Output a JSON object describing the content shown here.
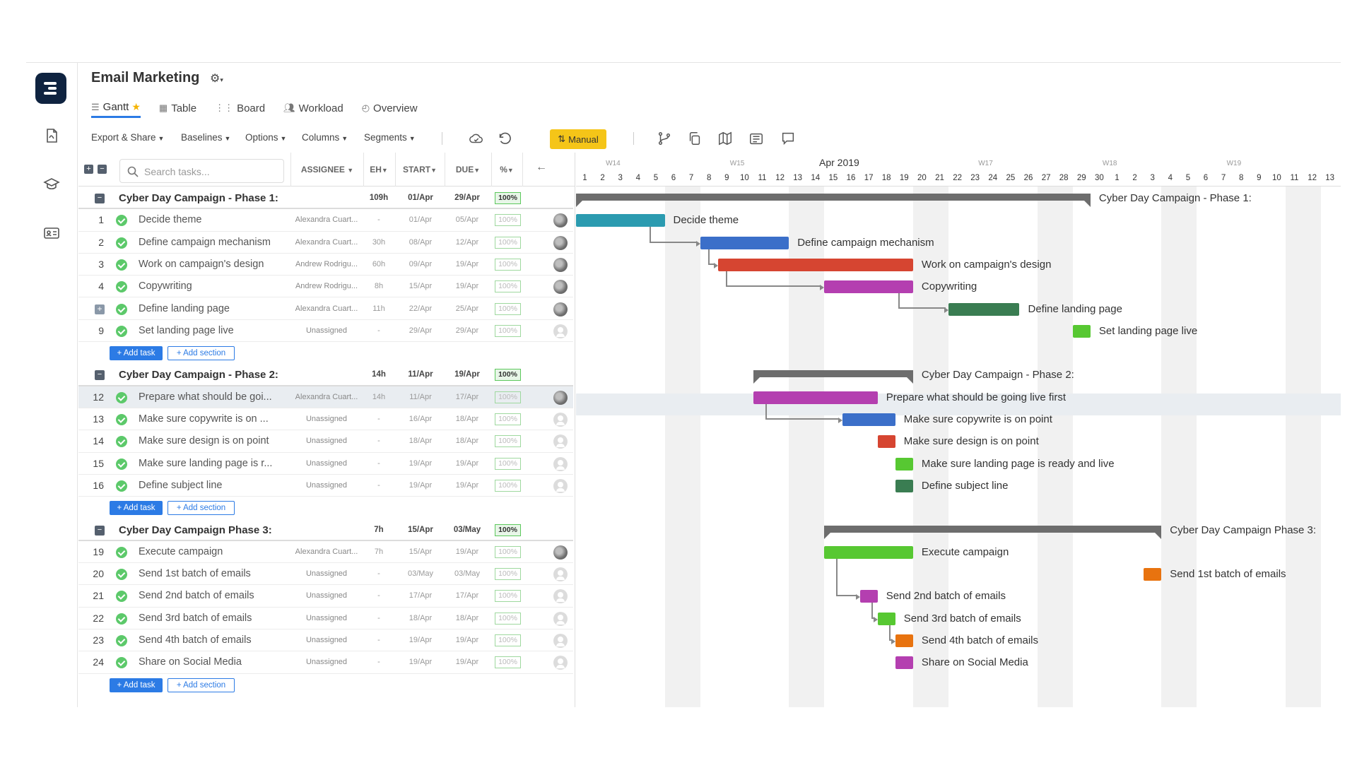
{
  "project": {
    "title": "Email Marketing"
  },
  "tabs": [
    {
      "label": "Gantt",
      "icon": "gantt-icon",
      "active": true,
      "starred": true
    },
    {
      "label": "Table",
      "icon": "table-icon"
    },
    {
      "label": "Board",
      "icon": "board-icon"
    },
    {
      "label": "Workload",
      "icon": "workload-icon"
    },
    {
      "label": "Overview",
      "icon": "overview-icon"
    }
  ],
  "toolbar": {
    "export": "Export & Share",
    "baselines": "Baselines",
    "options": "Options",
    "columns": "Columns",
    "segments": "Segments",
    "manual": "Manual"
  },
  "grid": {
    "search_placeholder": "Search tasks...",
    "columns": {
      "assignee": "ASSIGNEE",
      "eh": "EH",
      "start": "START",
      "due": "DUE",
      "pct": "%"
    },
    "add_task": "+ Add task",
    "add_section": "+ Add section"
  },
  "sections": [
    {
      "name": "Cyber Day Campaign - Phase 1:",
      "eh": "109h",
      "start": "01/Apr",
      "due": "29/Apr",
      "pct": "100%"
    },
    {
      "name": "Cyber Day Campaign - Phase 2:",
      "eh": "14h",
      "start": "11/Apr",
      "due": "19/Apr",
      "pct": "100%"
    },
    {
      "name": "Cyber Day Campaign Phase 3:",
      "eh": "7h",
      "start": "15/Apr",
      "due": "03/May",
      "pct": "100%"
    }
  ],
  "tasks": [
    {
      "num": "1",
      "name": "Decide theme",
      "assignee": "Alexandra Cuart...",
      "eh": "-",
      "start": "01/Apr",
      "due": "05/Apr",
      "pct": "100%",
      "avatar": "photo"
    },
    {
      "num": "2",
      "name": "Define campaign mechanism",
      "assignee": "Alexandra Cuart...",
      "eh": "30h",
      "start": "08/Apr",
      "due": "12/Apr",
      "pct": "100%",
      "avatar": "photo"
    },
    {
      "num": "3",
      "name": "Work on campaign's design",
      "assignee": "Andrew Rodrigu...",
      "eh": "60h",
      "start": "09/Apr",
      "due": "19/Apr",
      "pct": "100%",
      "avatar": "photo"
    },
    {
      "num": "4",
      "name": "Copywriting",
      "assignee": "Andrew Rodrigu...",
      "eh": "8h",
      "start": "15/Apr",
      "due": "19/Apr",
      "pct": "100%",
      "avatar": "photo"
    },
    {
      "num": "",
      "name": "Define landing page",
      "assignee": "Alexandra Cuart...",
      "eh": "11h",
      "start": "22/Apr",
      "due": "25/Apr",
      "pct": "100%",
      "avatar": "photo",
      "expandable": true
    },
    {
      "num": "9",
      "name": "Set landing page live",
      "assignee": "Unassigned",
      "eh": "-",
      "start": "29/Apr",
      "due": "29/Apr",
      "pct": "100%",
      "avatar": "unassigned"
    },
    {
      "num": "12",
      "name": "Prepare what should be goi...",
      "assignee": "Alexandra Cuart...",
      "eh": "14h",
      "start": "11/Apr",
      "due": "17/Apr",
      "pct": "100%",
      "avatar": "photo"
    },
    {
      "num": "13",
      "name": "Make sure copywrite is on ...",
      "assignee": "Unassigned",
      "eh": "-",
      "start": "16/Apr",
      "due": "18/Apr",
      "pct": "100%",
      "avatar": "unassigned"
    },
    {
      "num": "14",
      "name": "Make sure design is on point",
      "assignee": "Unassigned",
      "eh": "-",
      "start": "18/Apr",
      "due": "18/Apr",
      "pct": "100%",
      "avatar": "unassigned"
    },
    {
      "num": "15",
      "name": "Make sure landing page is r...",
      "assignee": "Unassigned",
      "eh": "-",
      "start": "19/Apr",
      "due": "19/Apr",
      "pct": "100%",
      "avatar": "unassigned"
    },
    {
      "num": "16",
      "name": "Define subject line",
      "assignee": "Unassigned",
      "eh": "-",
      "start": "19/Apr",
      "due": "19/Apr",
      "pct": "100%",
      "avatar": "unassigned"
    },
    {
      "num": "19",
      "name": "Execute campaign",
      "assignee": "Alexandra Cuart...",
      "eh": "7h",
      "start": "15/Apr",
      "due": "19/Apr",
      "pct": "100%",
      "avatar": "photo"
    },
    {
      "num": "20",
      "name": "Send 1st batch of emails",
      "assignee": "Unassigned",
      "eh": "-",
      "start": "03/May",
      "due": "03/May",
      "pct": "100%",
      "avatar": "unassigned"
    },
    {
      "num": "21",
      "name": "Send 2nd batch of emails",
      "assignee": "Unassigned",
      "eh": "-",
      "start": "17/Apr",
      "due": "17/Apr",
      "pct": "100%",
      "avatar": "unassigned"
    },
    {
      "num": "22",
      "name": "Send 3rd batch of emails",
      "assignee": "Unassigned",
      "eh": "-",
      "start": "18/Apr",
      "due": "18/Apr",
      "pct": "100%",
      "avatar": "unassigned"
    },
    {
      "num": "23",
      "name": "Send 4th batch of emails",
      "assignee": "Unassigned",
      "eh": "-",
      "start": "19/Apr",
      "due": "19/Apr",
      "pct": "100%",
      "avatar": "unassigned"
    },
    {
      "num": "24",
      "name": "Share on Social Media",
      "assignee": "Unassigned",
      "eh": "-",
      "start": "19/Apr",
      "due": "19/Apr",
      "pct": "100%",
      "avatar": "unassigned"
    }
  ],
  "timeline": {
    "month": "Apr 2019",
    "weeks": [
      "W14",
      "W15",
      "W17",
      "W18",
      "W19"
    ],
    "days": [
      "1",
      "2",
      "3",
      "4",
      "5",
      "6",
      "7",
      "8",
      "9",
      "10",
      "11",
      "12",
      "13",
      "14",
      "15",
      "16",
      "17",
      "18",
      "19",
      "20",
      "21",
      "22",
      "23",
      "24",
      "25",
      "26",
      "27",
      "28",
      "29",
      "30",
      "1",
      "2",
      "3",
      "4",
      "5",
      "6",
      "7",
      "8",
      "9",
      "10",
      "11",
      "12",
      "13"
    ]
  },
  "gantt_labels": {
    "phase1": "Cyber Day Campaign - Phase 1:",
    "phase2": "Cyber Day Campaign - Phase 2:",
    "phase3": "Cyber Day Campaign Phase 3:",
    "t1": "Decide theme",
    "t2": "Define campaign mechanism",
    "t3": "Work on campaign's design",
    "t4": "Copywriting",
    "t5": "Define landing page",
    "t9": "Set landing page live",
    "t12": "Prepare what should be going live first",
    "t13": "Make sure copywrite is on point",
    "t14": "Make sure design is on point",
    "t15": "Make sure landing page is ready and live",
    "t16": "Define subject line",
    "t19": "Execute campaign",
    "t20": "Send 1st batch of emails",
    "t21": "Send 2nd batch of emails",
    "t22": "Send 3rd batch of emails",
    "t23": "Send 4th batch of emails",
    "t24": "Share on Social Media"
  },
  "colors": {
    "teal": "#2b9bb0",
    "blue": "#3b6fc9",
    "red": "#d64531",
    "purple": "#b43fb0",
    "darkgreen": "#3a7d52",
    "green": "#57c832",
    "orange": "#e8730f",
    "summary": "#6d6d6d",
    "accent": "#2c7be5",
    "manual": "#f5c518"
  }
}
